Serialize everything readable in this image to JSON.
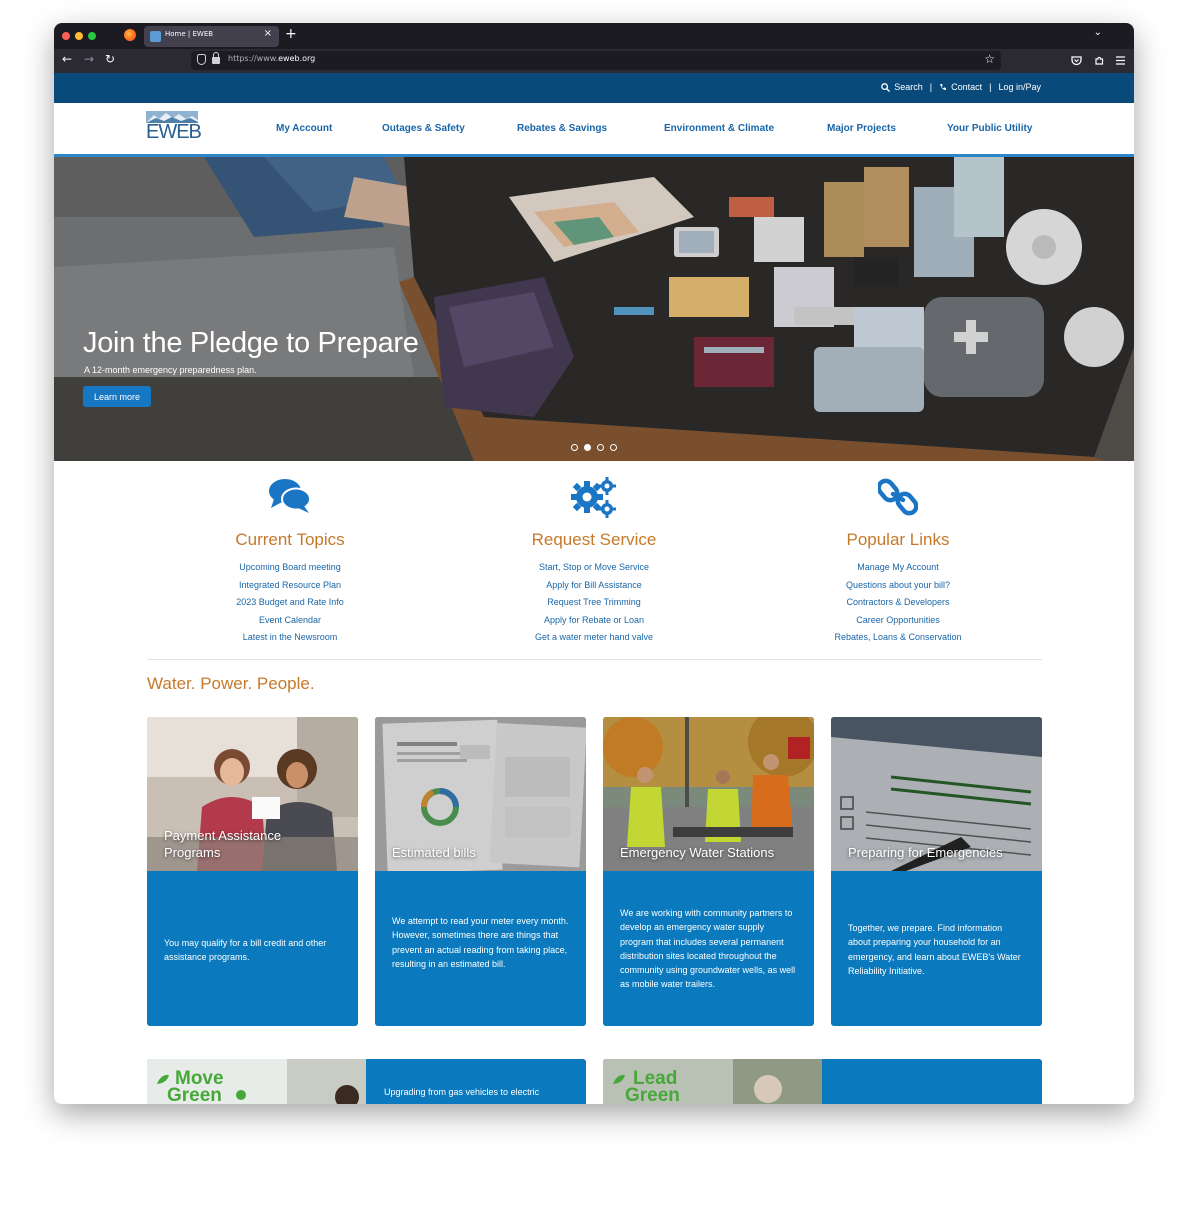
{
  "browser": {
    "tab_title": "Home | EWEB",
    "tab_close": "×",
    "new_tab": "+",
    "tab_list": "⌄",
    "url": "https://www.eweb.org",
    "url_prefix": "https://www.",
    "url_domain": "eweb.org",
    "back": "←",
    "forward": "→",
    "reload": "↻",
    "bookmark": "☆"
  },
  "utility": {
    "search_label": "Search",
    "contact_label": "Contact",
    "login_label": "Log in/Pay",
    "sep": "|"
  },
  "header": {
    "logo_text": "EWEB",
    "nav": [
      "My Account",
      "Outages & Safety",
      "Rebates & Savings",
      "Environment & Climate",
      "Major Projects",
      "Your Public Utility"
    ]
  },
  "hero": {
    "title": "Join the Pledge to Prepare",
    "subtitle": "A 12-month emergency preparedness plan.",
    "button": "Learn more",
    "slide_count": 4,
    "active_slide": 2
  },
  "quick_links": [
    {
      "icon": "chat-bubbles-icon",
      "title": "Current Topics",
      "links": [
        "Upcoming Board meeting",
        "Integrated Resource Plan",
        "2023 Budget and Rate Info",
        "Event Calendar",
        "Latest in the Newsroom"
      ]
    },
    {
      "icon": "gears-icon",
      "title": "Request Service",
      "links": [
        "Start, Stop or Move Service",
        "Apply for Bill Assistance",
        "Request Tree Trimming",
        "Apply for Rebate or Loan",
        "Get a water meter hand valve"
      ]
    },
    {
      "icon": "chain-link-icon",
      "title": "Popular Links",
      "links": [
        "Manage My Account",
        "Questions about your bill?",
        "Contractors & Developers",
        "Career Opportunities",
        "Rebates, Loans & Conservation"
      ]
    }
  ],
  "section_title": "Water. Power. People.",
  "cards": [
    {
      "title_line1": "Payment Assistance",
      "title_line2": "Programs",
      "text": "You may qualify for a bill credit and other assistance programs."
    },
    {
      "title_line1": "",
      "title_line2": "Estimated bills",
      "text": "We attempt to read your meter every month. However, sometimes there are things that prevent an actual reading from taking place, resulting in an estimated bill."
    },
    {
      "title_line1": "",
      "title_line2": "Emergency Water Stations",
      "text": "We are working with community partners to develop an emergency water supply program that includes several permanent distribution sites located throughout the community using groundwater wells, as well as mobile water trailers."
    },
    {
      "title_line1": "",
      "title_line2": "Preparing for Emergencies",
      "text": "Together, we prepare. Find information about preparing your household for an emergency, and learn about EWEB's Water Reliability Initiative."
    }
  ],
  "promos": [
    {
      "logo_word1": "Move",
      "logo_word2": "Green",
      "text": "Upgrading from gas vehicles to electric"
    },
    {
      "logo_word1": "Lead",
      "logo_word2": "Green",
      "text": ""
    }
  ],
  "colors": {
    "brand_blue": "#0a79bd",
    "dark_blue": "#0a4a7a",
    "accent_orange": "#c6792a",
    "link_blue": "#1a66a8"
  }
}
